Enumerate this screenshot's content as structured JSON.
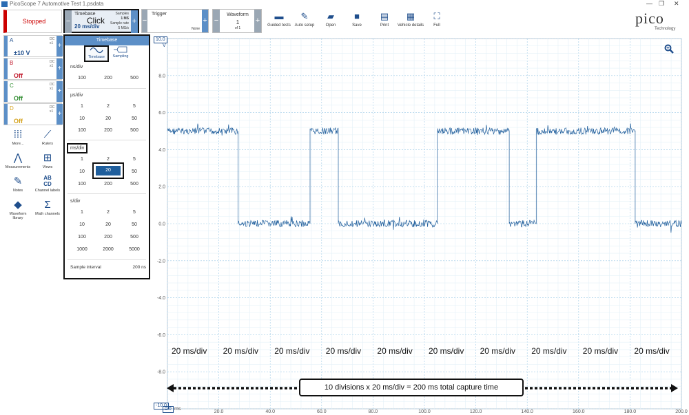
{
  "window": {
    "title": "PicoScope 7 Automotive Test 1.psdata",
    "controls": [
      "—",
      "❐",
      "✕"
    ]
  },
  "toolbar": {
    "status": "Stopped",
    "timebase": {
      "label": "Timebase",
      "value": "20 ms/div",
      "click_note": "Click",
      "samples_label": "Samples",
      "samples_value": "1 MS",
      "rate_label": "Sample rate",
      "rate_value": "5 MS/s"
    },
    "trigger": {
      "label": "Trigger",
      "mode": "None"
    },
    "waveform": {
      "label": "Waveform",
      "current": "1",
      "of": "of 1"
    },
    "buttons": [
      {
        "id": "guided",
        "label": "Guided tests",
        "icon": "car-icon",
        "glyph": "🚗"
      },
      {
        "id": "autosetup",
        "label": "Auto setup",
        "icon": "wand-icon",
        "glyph": "✎"
      },
      {
        "id": "open",
        "label": "Open",
        "icon": "folder-icon",
        "glyph": "▰"
      },
      {
        "id": "save",
        "label": "Save",
        "icon": "save-icon",
        "glyph": "■"
      },
      {
        "id": "print",
        "label": "Print",
        "icon": "print-icon",
        "glyph": "▤"
      },
      {
        "id": "vehicle",
        "label": "Vehicle details",
        "icon": "clipboard-icon",
        "glyph": "▦"
      },
      {
        "id": "full",
        "label": "Full",
        "icon": "fullscreen-icon",
        "glyph": "⛶"
      }
    ],
    "logo": "pico",
    "logo_sub": "Technology"
  },
  "channels": [
    {
      "name": "A",
      "value": "±10 V",
      "color": "#1f4e8c",
      "coupling": "DC",
      "probe": "x1"
    },
    {
      "name": "B",
      "value": "Off",
      "color": "#c0182b",
      "coupling": "DC",
      "probe": "x1"
    },
    {
      "name": "C",
      "value": "Off",
      "color": "#2e8b2e",
      "coupling": "DC",
      "probe": "x1"
    },
    {
      "name": "D",
      "value": "Off",
      "color": "#d4a017",
      "coupling": "DC",
      "probe": "x1"
    }
  ],
  "tools": [
    {
      "label": "More...",
      "icon": "grid-icon",
      "glyph": "⁞⁞⁞"
    },
    {
      "label": "Rulers",
      "icon": "ruler-icon",
      "glyph": "⟋"
    },
    {
      "label": "Measurements",
      "icon": "compass-icon",
      "glyph": "⋀"
    },
    {
      "label": "Views",
      "icon": "views-icon",
      "glyph": "⊞"
    },
    {
      "label": "Notes",
      "icon": "notes-icon",
      "glyph": "✎"
    },
    {
      "label": "Channel labels",
      "icon": "abcd-icon",
      "glyph": "AB CD"
    },
    {
      "label": "Waveform library",
      "icon": "library-icon",
      "glyph": "◆"
    },
    {
      "label": "Math channels",
      "icon": "sigma-icon",
      "glyph": "Σ"
    }
  ],
  "timebase_panel": {
    "header": "Timebase",
    "tab_timebase": "Timebase",
    "tab_sampling": "Sampling",
    "ns": {
      "label": "ns/div",
      "values": [
        "100",
        "200",
        "500"
      ]
    },
    "us": {
      "label": "µs/div",
      "values": [
        "1",
        "2",
        "5",
        "10",
        "20",
        "50",
        "100",
        "200",
        "500"
      ]
    },
    "ms": {
      "label": "ms/div",
      "values": [
        "1",
        "2",
        "5",
        "10",
        "20",
        "50",
        "100",
        "200",
        "500"
      ],
      "selected": "20"
    },
    "s": {
      "label": "s/div",
      "values": [
        "1",
        "2",
        "5",
        "10",
        "20",
        "50",
        "100",
        "200",
        "500",
        "1000",
        "2000",
        "5000"
      ]
    },
    "sample_interval_label": "Sample interval",
    "sample_interval_value": "200 ns"
  },
  "plot": {
    "y_top_box": "10.0",
    "y_unit": "V",
    "y_bottom_box": "-10.0",
    "x_first_box": "0.0",
    "x_unit": "ms",
    "zoom_icon": "zoom-icon",
    "division_label": "20 ms/div",
    "annotation": "10 divisions x 20 ms/div = 200 ms total capture time"
  },
  "chart_data": {
    "type": "line",
    "y_ticks": [
      "8.0",
      "6.0",
      "4.0",
      "2.0",
      "0.0",
      "-2.0",
      "-4.0",
      "-6.0",
      "-8.0"
    ],
    "x_ticks": [
      "20.0",
      "40.0",
      "60.0",
      "80.0",
      "100.0",
      "120.0",
      "140.0",
      "160.0",
      "180.0",
      "200.0"
    ],
    "xlim": [
      0,
      200
    ],
    "ylim": [
      -10,
      10
    ],
    "grid": true,
    "line_color": "#1f5e9c",
    "segments": [
      {
        "x0": 0,
        "x1": 27.5,
        "level": 5
      },
      {
        "x0": 27.5,
        "x1": 55.5,
        "level": 0
      },
      {
        "x0": 55.5,
        "x1": 66.5,
        "level": 5
      },
      {
        "x0": 66.5,
        "x1": 105,
        "level": 0
      },
      {
        "x0": 105,
        "x1": 133,
        "level": 5
      },
      {
        "x0": 133,
        "x1": 143.5,
        "level": 0
      },
      {
        "x0": 143.5,
        "x1": 182,
        "level": 5
      },
      {
        "x0": 182,
        "x1": 200,
        "level": 0
      }
    ]
  }
}
